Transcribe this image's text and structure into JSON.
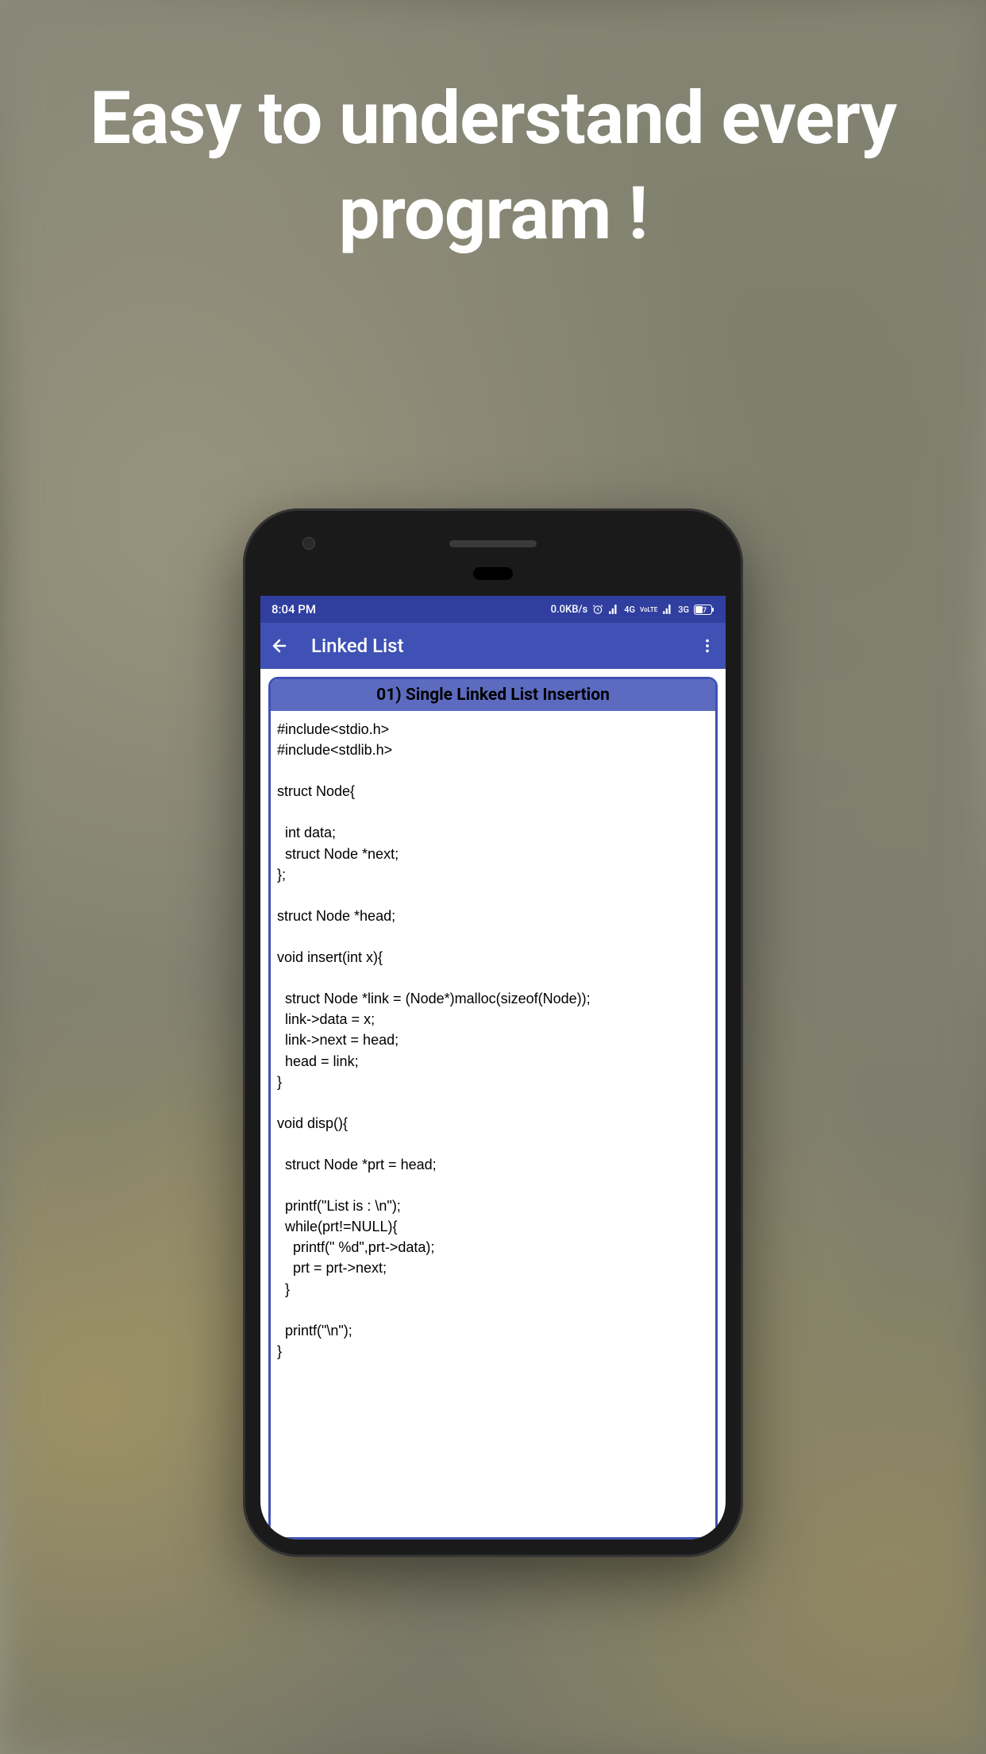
{
  "headline": "Easy to understand every program !",
  "statusbar": {
    "time": "8:04 PM",
    "data_rate": "0.0KB/s",
    "net1": "4G",
    "net1_sub": "VoLTE",
    "net2": "3G",
    "battery": "47"
  },
  "appbar": {
    "title": "Linked List"
  },
  "card": {
    "title": "01) Single Linked List Insertion",
    "code": "#include<stdio.h>\n#include<stdlib.h>\n\nstruct Node{\n\n  int data;\n  struct Node *next;\n};\n\nstruct Node *head;\n\nvoid insert(int x){\n\n  struct Node *link = (Node*)malloc(sizeof(Node));\n  link->data = x;\n  link->next = head;\n  head = link;\n}\n\nvoid disp(){\n\n  struct Node *prt = head;\n\n  printf(\"List is : \\n\");\n  while(prt!=NULL){\n    printf(\" %d\",prt->data);\n    prt = prt->next;\n  }\n\n  printf(\"\\n\");\n}"
  }
}
